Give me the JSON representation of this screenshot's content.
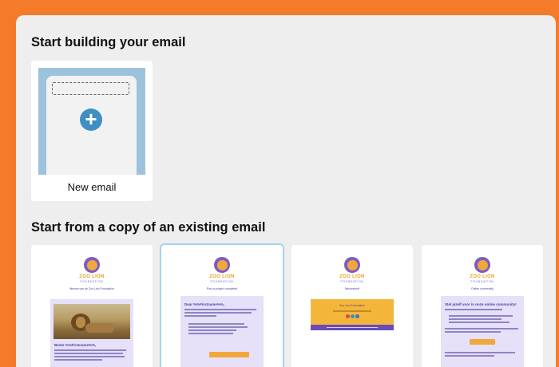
{
  "headings": {
    "start_building": "Start building your email",
    "start_from_copy": "Start from a copy of an existing email"
  },
  "new_email": {
    "label": "New email",
    "icon": "plus-icon"
  },
  "brand": {
    "name": "ZOO LION",
    "subtitle": "FOUNDATION"
  },
  "templates": [
    {
      "subtitle": "Nieuws van de Zoo Lion Foundation",
      "title": "Beste %%Firstname%%,",
      "selected": false
    },
    {
      "subtitle": "Post a project completed",
      "title": "Dear %%Firstname%%,",
      "button": "Ready to see our latest work",
      "selected": true
    },
    {
      "subtitle": "Nieuwsbrief",
      "title": "Zoo Lion Foundation",
      "selected": false
    },
    {
      "subtitle": "Online community",
      "title": "Stel jezelf voor in onze online community!",
      "button": "Stel jezelf voor",
      "selected": false
    }
  ],
  "colors": {
    "background": "#F47B2A",
    "panel": "#EEEEEF",
    "accent_blue": "#3F8FC4",
    "brand_purple": "#7C5CC4",
    "brand_yellow": "#F0A83C",
    "selected_outline": "#A8D2EF"
  }
}
